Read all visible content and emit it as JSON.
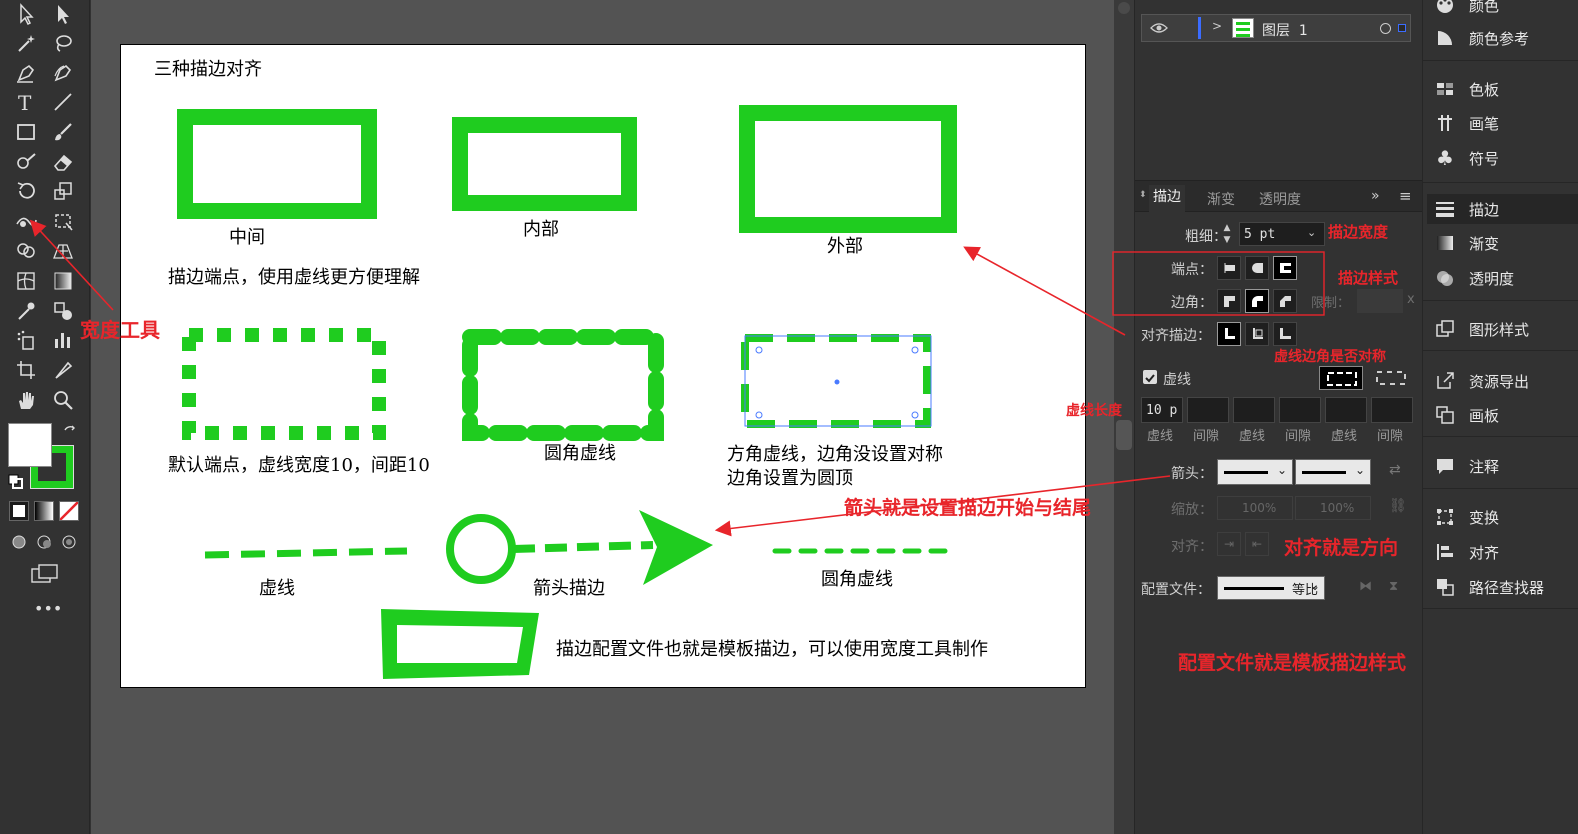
{
  "layers": {
    "name": "图层  1"
  },
  "artboard": {
    "title": "三种描边对齐",
    "labels": {
      "middle": "中间",
      "inside": "内部",
      "outside": "外部",
      "cap_note": "描边端点，使用虚线更方便理解",
      "default_cap": "默认端点，虚线宽度10，间距10",
      "round_dash": "圆角虚线",
      "square_dash_1": "方角虚线，边角没设置对称",
      "square_dash_2": "边角设置为圆顶",
      "dash": "虚线",
      "arrow_stroke": "箭头描边",
      "round_dash_2": "圆角虚线",
      "profile_note": "描边配置文件也就是模板描边，可以使用宽度工具制作"
    }
  },
  "annotations": {
    "width_tool": "宽度工具",
    "stroke_width": "描边宽度",
    "stroke_style": "描边样式",
    "dash_corner": "虚线边角是否对称",
    "dash_length": "虚线长度",
    "arrow_note": "箭头就是设置描边开始与结尾",
    "align_note": "对齐就是方向",
    "profile_note": "配置文件就是模板描边样式"
  },
  "stroke_panel": {
    "tabs": [
      "描边",
      "渐变",
      "透明度"
    ],
    "weight_label": "粗细：",
    "weight_value": "5 pt",
    "cap_label": "端点：",
    "corner_label": "边角：",
    "limit_label": "限制：",
    "limit_suffix": "x",
    "align_label": "对齐描边：",
    "dashed_label": "虚线",
    "dash_value": "10 p",
    "dash_labels": [
      "虚线",
      "间隙",
      "虚线",
      "间隙",
      "虚线",
      "间隙"
    ],
    "arrow_label": "箭头：",
    "scale_label": "缩放：",
    "scale_values": [
      "100%",
      "100%"
    ],
    "align2_label": "对齐：",
    "profile_label": "配置文件：",
    "profile_value": "等比"
  },
  "dock": {
    "items": [
      "颜色",
      "颜色参考",
      "色板",
      "画笔",
      "符号",
      "描边",
      "渐变",
      "透明度",
      "图形样式",
      "资源导出",
      "画板",
      "注释",
      "变换",
      "对齐",
      "路径查找器"
    ]
  },
  "colors": {
    "accent_green": "#1fcc1f",
    "annotation_red": "#e8252b"
  }
}
